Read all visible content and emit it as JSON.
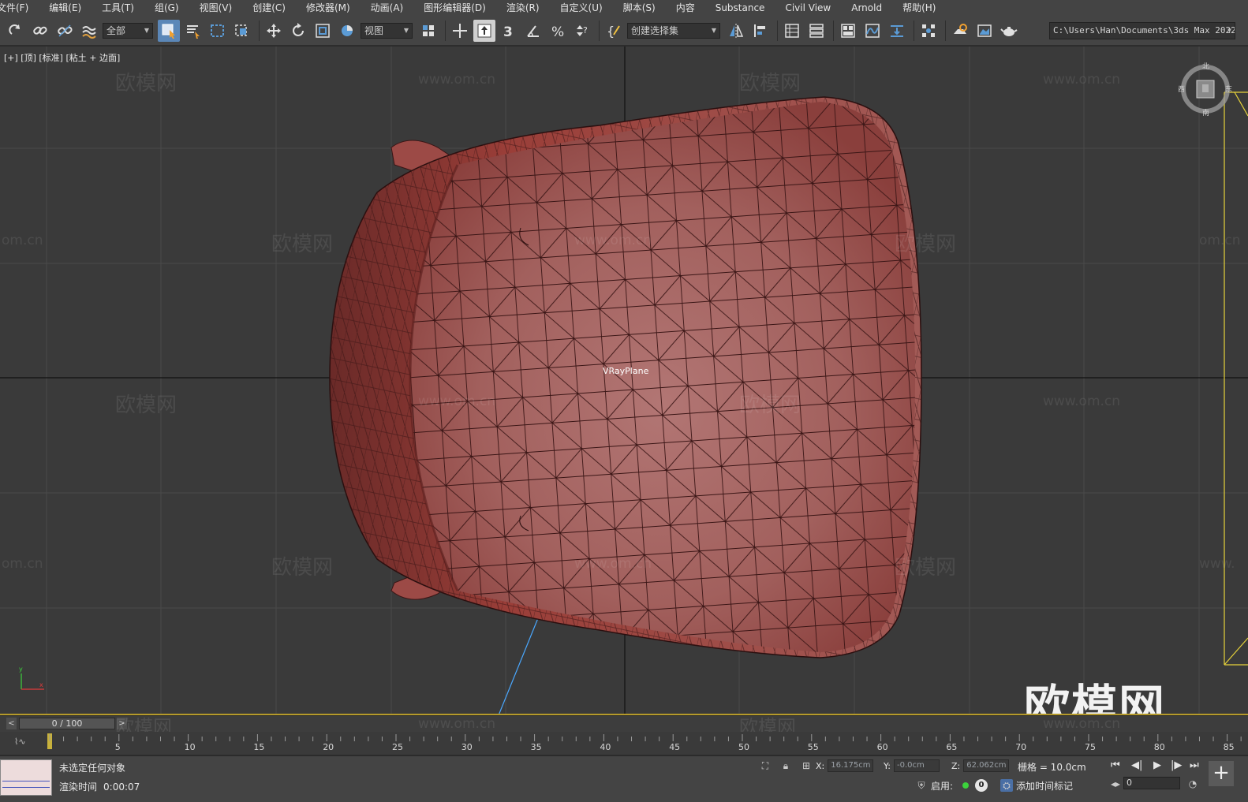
{
  "menu": [
    "文件(F)",
    "编辑(E)",
    "工具(T)",
    "组(G)",
    "视图(V)",
    "创建(C)",
    "修改器(M)",
    "动画(A)",
    "图形编辑器(D)",
    "渲染(R)",
    "自定义(U)",
    "脚本(S)",
    "内容",
    "Substance",
    "Civil View",
    "Arnold",
    "帮助(H)"
  ],
  "toolbar": {
    "filter_dropdown": "全部",
    "ref_coord_dropdown": "视图",
    "selection_set_dropdown": "创建选择集",
    "project_path": "C:\\Users\\Han\\Documents\\3ds Max 2022"
  },
  "viewport": {
    "label": "[+] [顶] [标准] [粘土 + 边面]",
    "object_label": "VRayPlane",
    "watermark_text": "欧模网",
    "watermark_url": "www.om.cn",
    "watermark_url_short": "om.cn",
    "watermark_url_edge": "www.",
    "brand_logo": "欧模网",
    "viewcube": {
      "n": "北",
      "s": "南",
      "w": "西",
      "e": "东"
    },
    "axis_tripod": {
      "x": "x",
      "y": "y"
    }
  },
  "timeline": {
    "frame_display": "0 / 100",
    "prev": "<",
    "next": ">",
    "ticks": [
      "5",
      "10",
      "15",
      "20",
      "25",
      "30",
      "35",
      "40",
      "45",
      "50",
      "55",
      "60",
      "65",
      "70",
      "75",
      "80",
      "85"
    ],
    "curve_label": "⌇∿"
  },
  "status": {
    "message": "未选定任何对象",
    "render_time_label": "渲染时间",
    "render_time_value": "0:00:07",
    "x_label": "X:",
    "x_value": "16.175cm",
    "y_label": "Y:",
    "y_value": "-0.0cm",
    "z_label": "Z:",
    "z_value": "62.062cm",
    "grid": "栅格 = 10.0cm",
    "enable_label": "启用:",
    "count": "0",
    "add_time_tag": "添加时间标记",
    "frame_value": "0",
    "plus": "+"
  },
  "colors": {
    "viewport_bg": "#3a3a3a",
    "mesh_fill": "#a85a58",
    "mesh_edge": "#3a1a1a",
    "accent_blue": "#5b87b8",
    "timeline_accent": "#b59a2a"
  }
}
